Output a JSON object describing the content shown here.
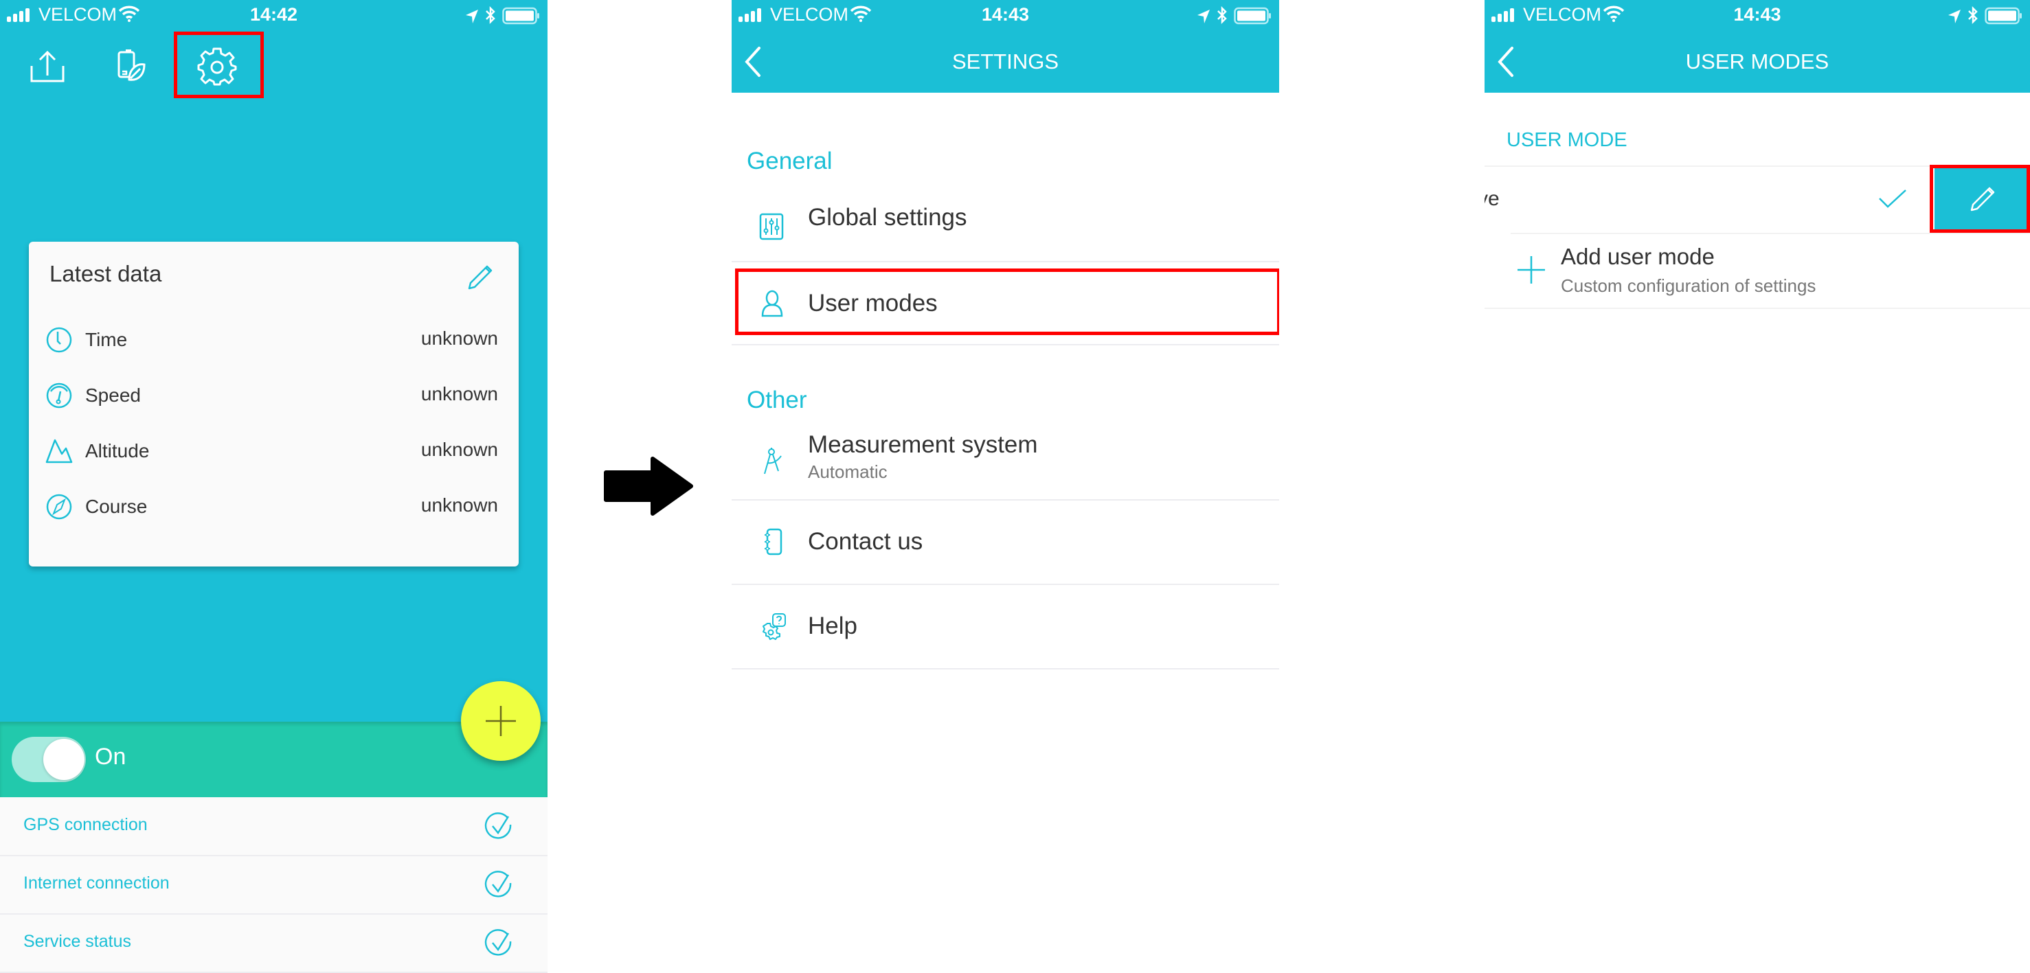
{
  "colors": {
    "primary": "#1bbfd6",
    "teal_band": "#22c9ac",
    "fab": "#eeff41",
    "highlight": "#ff0000",
    "text_dark": "#333333",
    "text_gray": "#777777"
  },
  "panel1": {
    "status": {
      "carrier": "VELCOM",
      "time": "14:42"
    },
    "toolbar": {
      "icons": [
        "upload-icon",
        "battery-eco-icon",
        "gear-icon"
      ]
    },
    "card": {
      "title": "Latest data",
      "rows": [
        {
          "label": "Time",
          "value": "unknown",
          "icon": "clock-icon"
        },
        {
          "label": "Speed",
          "value": "unknown",
          "icon": "speedometer-icon"
        },
        {
          "label": "Altitude",
          "value": "unknown",
          "icon": "mountain-icon"
        },
        {
          "label": "Course",
          "value": "unknown",
          "icon": "compass-icon"
        }
      ]
    },
    "toggle": {
      "label": "On",
      "state": true
    },
    "fab_icon": "plus-icon",
    "status_list": [
      {
        "label": "GPS connection",
        "ok": true
      },
      {
        "label": "Internet connection",
        "ok": true
      },
      {
        "label": "Service status",
        "ok": true
      }
    ]
  },
  "panel2": {
    "status": {
      "carrier": "VELCOM",
      "time": "14:43"
    },
    "title": "SETTINGS",
    "sections": [
      {
        "header": "General",
        "items": [
          {
            "label": "Global settings",
            "icon": "sliders-icon"
          },
          {
            "label": "User modes",
            "icon": "user-icon"
          }
        ]
      },
      {
        "header": "Other",
        "items": [
          {
            "label": "Measurement system",
            "sublabel": "Automatic",
            "icon": "compass-drawing-icon"
          },
          {
            "label": "Contact us",
            "icon": "notebook-icon"
          },
          {
            "label": "Help",
            "icon": "help-gear-icon"
          }
        ]
      }
    ]
  },
  "panel3": {
    "status": {
      "carrier": "VELCOM",
      "time": "14:43"
    },
    "title": "USER MODES",
    "section_header": "USER MODE",
    "mode_row": {
      "label_fragment": "ve",
      "selected": true
    },
    "add_item": {
      "label": "Add user mode",
      "sublabel": "Custom configuration of settings"
    }
  }
}
